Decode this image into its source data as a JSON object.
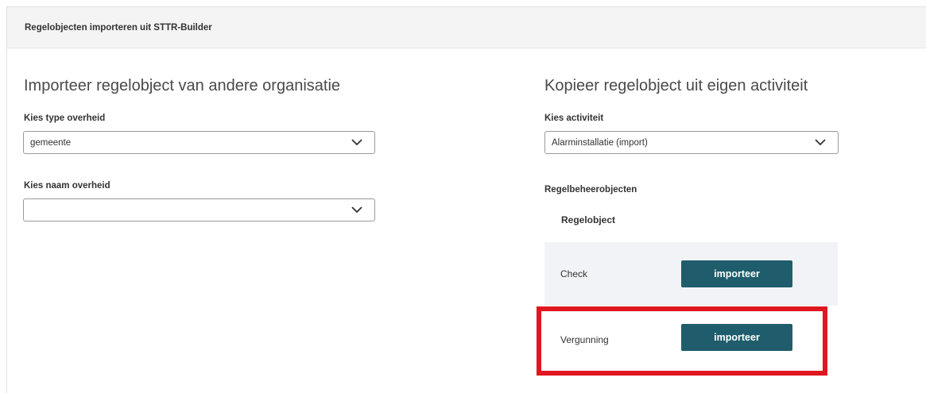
{
  "panel": {
    "title": "Regelobjecten importeren uit STTR-Builder"
  },
  "left": {
    "title": "Importeer regelobject van andere organisatie",
    "type_label": "Kies type overheid",
    "type_value": "gemeente",
    "name_label": "Kies naam overheid",
    "name_value": ""
  },
  "right": {
    "title": "Kopieer regelobject uit eigen activiteit",
    "activity_label": "Kies activiteit",
    "activity_value": "Alarminstallatie (import)",
    "section_label": "Regelbeheerobjecten",
    "table_header": "Regelobject",
    "rows": [
      {
        "label": "Check",
        "button": "importeer"
      },
      {
        "label": "Vergunning",
        "button": "importeer"
      }
    ]
  },
  "colors": {
    "accent": "#1f5d6c",
    "highlight": "#e0171f",
    "row_alt": "#f1f3f6"
  }
}
